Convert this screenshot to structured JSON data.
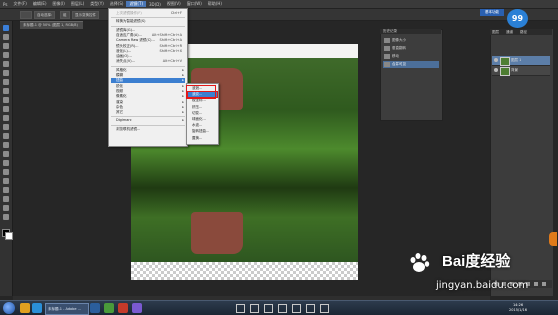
{
  "menubar": {
    "items": [
      "Ps",
      "文件(F)",
      "编辑(E)",
      "图像(I)",
      "图层(L)",
      "类型(Y)",
      "选择(S)",
      "滤镜(T)",
      "3D(D)",
      "视图(V)",
      "窗口(W)",
      "帮助(H)"
    ],
    "active_index": 7
  },
  "optionsbar": {
    "items": [
      "自动选择:",
      "组",
      "显示变换控件"
    ]
  },
  "document": {
    "tab_label": "未标题-1 @ 50% (图层 1, RGB/8)"
  },
  "filter_menu": {
    "items": [
      {
        "label": "上次滤镜操作(F)",
        "shortcut": "Ctrl+F",
        "disabled": true
      },
      {
        "separator": true
      },
      {
        "label": "转换为智能滤镜(S)"
      },
      {
        "separator": true
      },
      {
        "label": "滤镜库(G)..."
      },
      {
        "label": "自适应广角(A)...",
        "shortcut": "Alt+Shift+Ctrl+A"
      },
      {
        "label": "Camera Raw 滤镜(C)...",
        "shortcut": "Shift+Ctrl+A"
      },
      {
        "label": "镜头校正(R)...",
        "shortcut": "Shift+Ctrl+R"
      },
      {
        "label": "液化(L)...",
        "shortcut": "Shift+Ctrl+X"
      },
      {
        "label": "油画(O)..."
      },
      {
        "label": "消失点(V)...",
        "shortcut": "Alt+Ctrl+V"
      },
      {
        "separator": true
      },
      {
        "label": "风格化",
        "submenu": true
      },
      {
        "label": "模糊",
        "submenu": true
      },
      {
        "label": "扭曲",
        "submenu": true,
        "highlighted": true
      },
      {
        "label": "锐化",
        "submenu": true
      },
      {
        "label": "视频",
        "submenu": true
      },
      {
        "label": "像素化",
        "submenu": true
      },
      {
        "label": "渲染",
        "submenu": true
      },
      {
        "label": "杂色",
        "submenu": true
      },
      {
        "label": "其它",
        "submenu": true
      },
      {
        "separator": true
      },
      {
        "label": "Digimarc",
        "submenu": true
      },
      {
        "separator": true
      },
      {
        "label": "浏览联机滤镜..."
      }
    ]
  },
  "distort_submenu": {
    "items": [
      "波浪...",
      "波纹...",
      "极坐标...",
      "挤压...",
      "切变...",
      "球面化...",
      "水波...",
      "旋转扭曲...",
      "置换..."
    ],
    "highlighted_index": 1
  },
  "history_panel": {
    "header": "历史记录",
    "items": [
      "图像大小",
      "垂直翻转",
      "移动",
      "合并可见"
    ]
  },
  "layers_panel": {
    "tabs": [
      "图层",
      "通道",
      "路径"
    ],
    "layers": [
      "图层 1",
      "背景"
    ],
    "selected_index": 0
  },
  "badge": {
    "text": "99"
  },
  "topright_button": {
    "label": "基本功能"
  },
  "taskbar": {
    "ps_label": "未标题-1 - Adobe ...",
    "clock_time": "14:26",
    "clock_date": "2015/1/16"
  },
  "watermark": {
    "brand": "Bai度经验",
    "url": "jingyan.baidu.com"
  },
  "colors": {
    "accent": "#3c7fd0",
    "highlight_box": "#e21818",
    "ps_panel": "#3c3c3c"
  }
}
